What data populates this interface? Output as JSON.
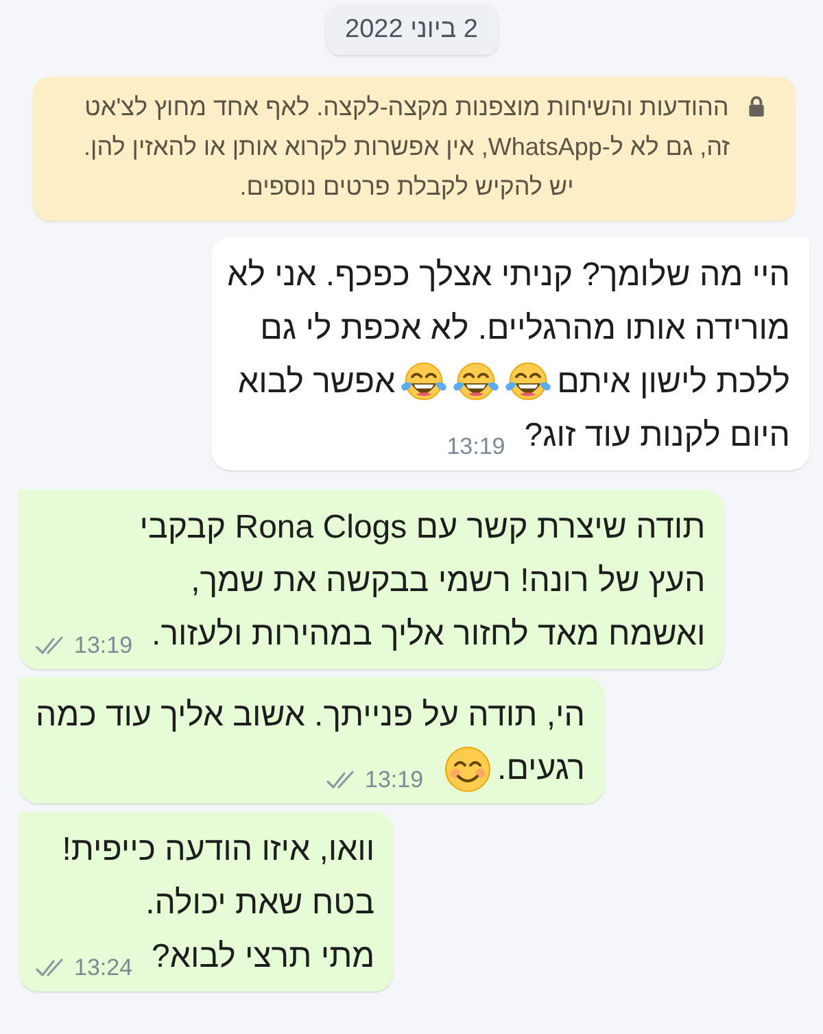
{
  "date_chip": "2 ביוני 2022",
  "encryption_notice": {
    "text": "ההודעות והשיחות מוצפנות מקצה-לקצה. לאף אחד מחוץ לצ'אט זה, גם לא ל-WhatsApp, אין אפשרות לקרוא אותן או להאזין להן. יש להקיש לקבלת פרטים נוספים."
  },
  "messages": [
    {
      "outgoing": false,
      "time": "13:19",
      "lines": [
        [
          {
            "kind": "text",
            "text": "היי מה שלומך? קניתי אצלך כפכף. אני לא"
          }
        ],
        [
          {
            "kind": "text",
            "text": "מורידה אותו מהרגליים. לא אכפת לי גם"
          }
        ],
        [
          {
            "kind": "text",
            "text": "ללכת לישון איתם"
          },
          {
            "kind": "laugh"
          },
          {
            "kind": "laugh"
          },
          {
            "kind": "laugh"
          },
          {
            "kind": "text",
            "text": "אפשר לבוא"
          }
        ],
        [
          {
            "kind": "text",
            "text": "היום לקנות עוד זוג?"
          }
        ]
      ]
    },
    {
      "outgoing": true,
      "time": "13:19",
      "read": false,
      "lines": [
        [
          {
            "kind": "text",
            "text": "תודה שיצרת קשר עם Rona Clogs קבקבי"
          }
        ],
        [
          {
            "kind": "text",
            "text": "העץ של רונה! רשמי בבקשה את שמך,"
          }
        ],
        [
          {
            "kind": "text",
            "text": "ואשמח מאד לחזור אליך במהירות ולעזור."
          }
        ]
      ]
    },
    {
      "outgoing": true,
      "time": "13:19",
      "read": false,
      "lines": [
        [
          {
            "kind": "text",
            "text": "הי, תודה על פנייתך. אשוב אליך עוד כמה"
          }
        ],
        [
          {
            "kind": "text",
            "text": "רגעים."
          },
          {
            "kind": "smile"
          }
        ]
      ]
    },
    {
      "outgoing": true,
      "time": "13:24",
      "read": false,
      "lines": [
        [
          {
            "kind": "text",
            "text": "וואו, איזו הודעה כייפית!"
          }
        ],
        [
          {
            "kind": "text",
            "text": "בטח שאת יכולה."
          }
        ],
        [
          {
            "kind": "text",
            "text": "מתי תרצי לבוא?"
          }
        ]
      ]
    }
  ]
}
